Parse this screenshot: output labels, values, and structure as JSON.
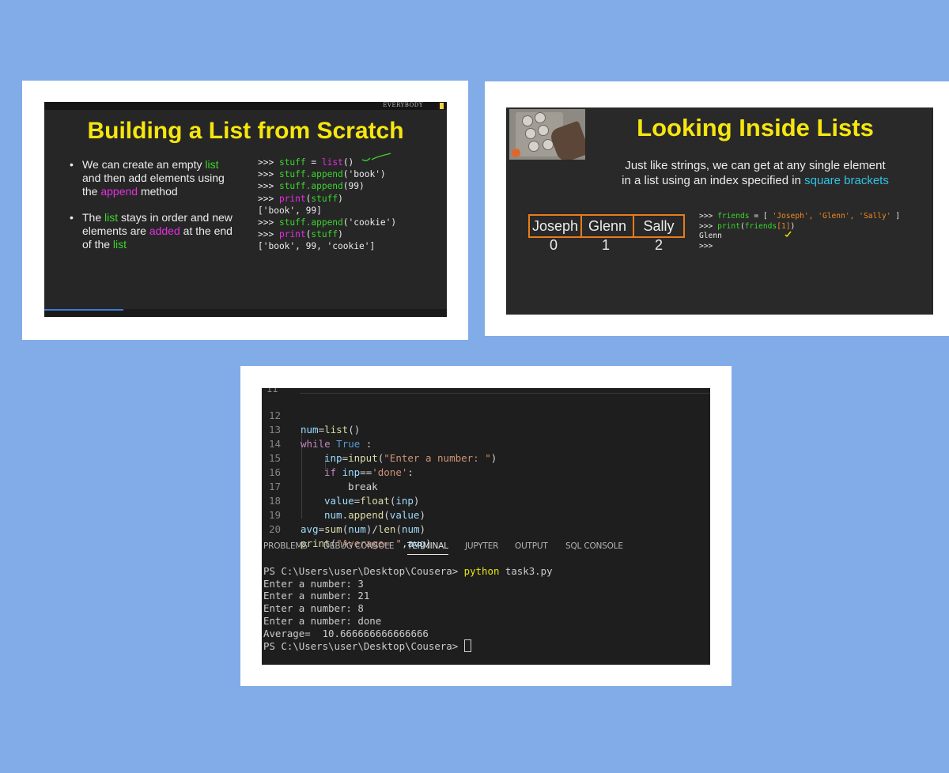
{
  "slide1": {
    "header_tag": "EVERYBODY",
    "title": "Building a List from Scratch",
    "bullet1": [
      "We can create an empty ",
      "list",
      " and then add elements using the ",
      "append",
      " method"
    ],
    "bullet2": [
      "The ",
      "list",
      " stays in order and new elements are ",
      "added",
      " at the end of the ",
      "list"
    ],
    "bullet_symbol": "•",
    "code": [
      [
        ">>> ",
        "stuff",
        " = ",
        "list",
        "()"
      ],
      [
        ">>> ",
        "stuff.append",
        "('book')"
      ],
      [
        ">>> ",
        "stuff.append",
        "(99)"
      ],
      [
        ">>> ",
        "print",
        "(",
        "stuff",
        ")"
      ],
      [
        "['book', 99]"
      ],
      [
        ">>> ",
        "stuff.append",
        "('cookie')"
      ],
      [
        ">>> ",
        "print",
        "(",
        "stuff",
        ")"
      ],
      [
        "['book', 99, 'cookie']"
      ]
    ],
    "colors": {
      "title": "#f6e60f",
      "green": "#3bd62c",
      "magenta": "#e52fe0"
    }
  },
  "slide2": {
    "title": "Looking Inside Lists",
    "subtitle_line1": "Just like strings, we can get at any single element",
    "subtitle_line2_pre": "in a list using an index specified in ",
    "subtitle_line2_hl": "square brackets",
    "boxes": [
      "Joseph",
      "Glenn",
      "Sally"
    ],
    "indices": [
      "0",
      "1",
      "2"
    ],
    "code": {
      "l1_prompt": ">>> ",
      "l1_var": "friends",
      "l1_eq": " = [ ",
      "l1_list": "'Joseph', 'Glenn', 'Sally'",
      "l1_end": " ]",
      "l2_prompt": ">>> ",
      "l2_fn": "print",
      "l2_open": "(",
      "l2_arg": "friends",
      "l2_idx": "[1]",
      "l2_close": ")",
      "l3": "Glenn",
      "l4": ">>>"
    },
    "colors": {
      "title": "#f6e60f",
      "box_border": "#e87c1a",
      "highlight": "#2fc4e6"
    }
  },
  "editor": {
    "partial_line_number": "11",
    "lines": [
      {
        "n": "12",
        "text": "num=list()"
      },
      {
        "n": "13",
        "text": "while True :"
      },
      {
        "n": "14",
        "text": "inp=input(\"Enter a number: \")"
      },
      {
        "n": "15",
        "text": "if inp=='done':"
      },
      {
        "n": "16",
        "text": "break"
      },
      {
        "n": "17",
        "text": "value=float(inp)"
      },
      {
        "n": "18",
        "text": "num.append(value)"
      },
      {
        "n": "19",
        "text": "avg=sum(num)/len(num)"
      },
      {
        "n": "20",
        "text": "print(\"Average= \",avg)"
      }
    ]
  },
  "panel_tabs": {
    "problems": "PROBLEMS",
    "debug_console": "DEBUG CONSOLE",
    "terminal": "TERMINAL",
    "jupyter": "JUPYTER",
    "output": "OUTPUT",
    "sql_console": "SQL CONSOLE",
    "active": "TERMINAL"
  },
  "terminal": {
    "prompt1": "PS C:\\Users\\user\\Desktop\\Cousera> ",
    "command": "python",
    "command_arg": " task3.py",
    "output": [
      "Enter a number: 3",
      "Enter a number: 21",
      "Enter a number: 8",
      "Enter a number: done",
      "Average=  10.666666666666666"
    ],
    "prompt2": "PS C:\\Users\\user\\Desktop\\Cousera> "
  }
}
